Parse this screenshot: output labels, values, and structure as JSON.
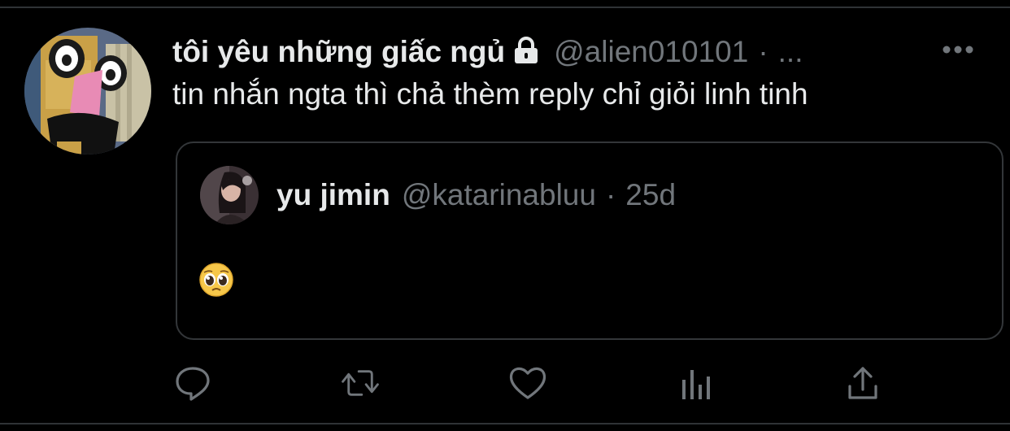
{
  "tweet": {
    "display_name": "tôi yêu những giấc ngủ",
    "handle": "@alien010101",
    "separator": "·",
    "time": "...",
    "text": "tin nhắn ngta thì chả thèm reply chỉ giỏi linh tinh",
    "avatar_icon": "avatar-image",
    "lock_icon": "lock-icon",
    "more_icon": "more-horizontal-icon"
  },
  "quote": {
    "display_name": "yu jimin",
    "handle": "@katarinabluu",
    "separator": "·",
    "time": "25d",
    "text": "🥺"
  },
  "actions": [
    {
      "name": "reply",
      "icon": "reply-icon"
    },
    {
      "name": "retweet",
      "icon": "retweet-icon"
    },
    {
      "name": "like",
      "icon": "heart-icon"
    },
    {
      "name": "analytics",
      "icon": "analytics-icon"
    },
    {
      "name": "share",
      "icon": "share-icon"
    }
  ],
  "colors": {
    "background": "#000000",
    "primary_text": "#e7e9ea",
    "secondary_text": "#71767b",
    "border": "#333639"
  }
}
